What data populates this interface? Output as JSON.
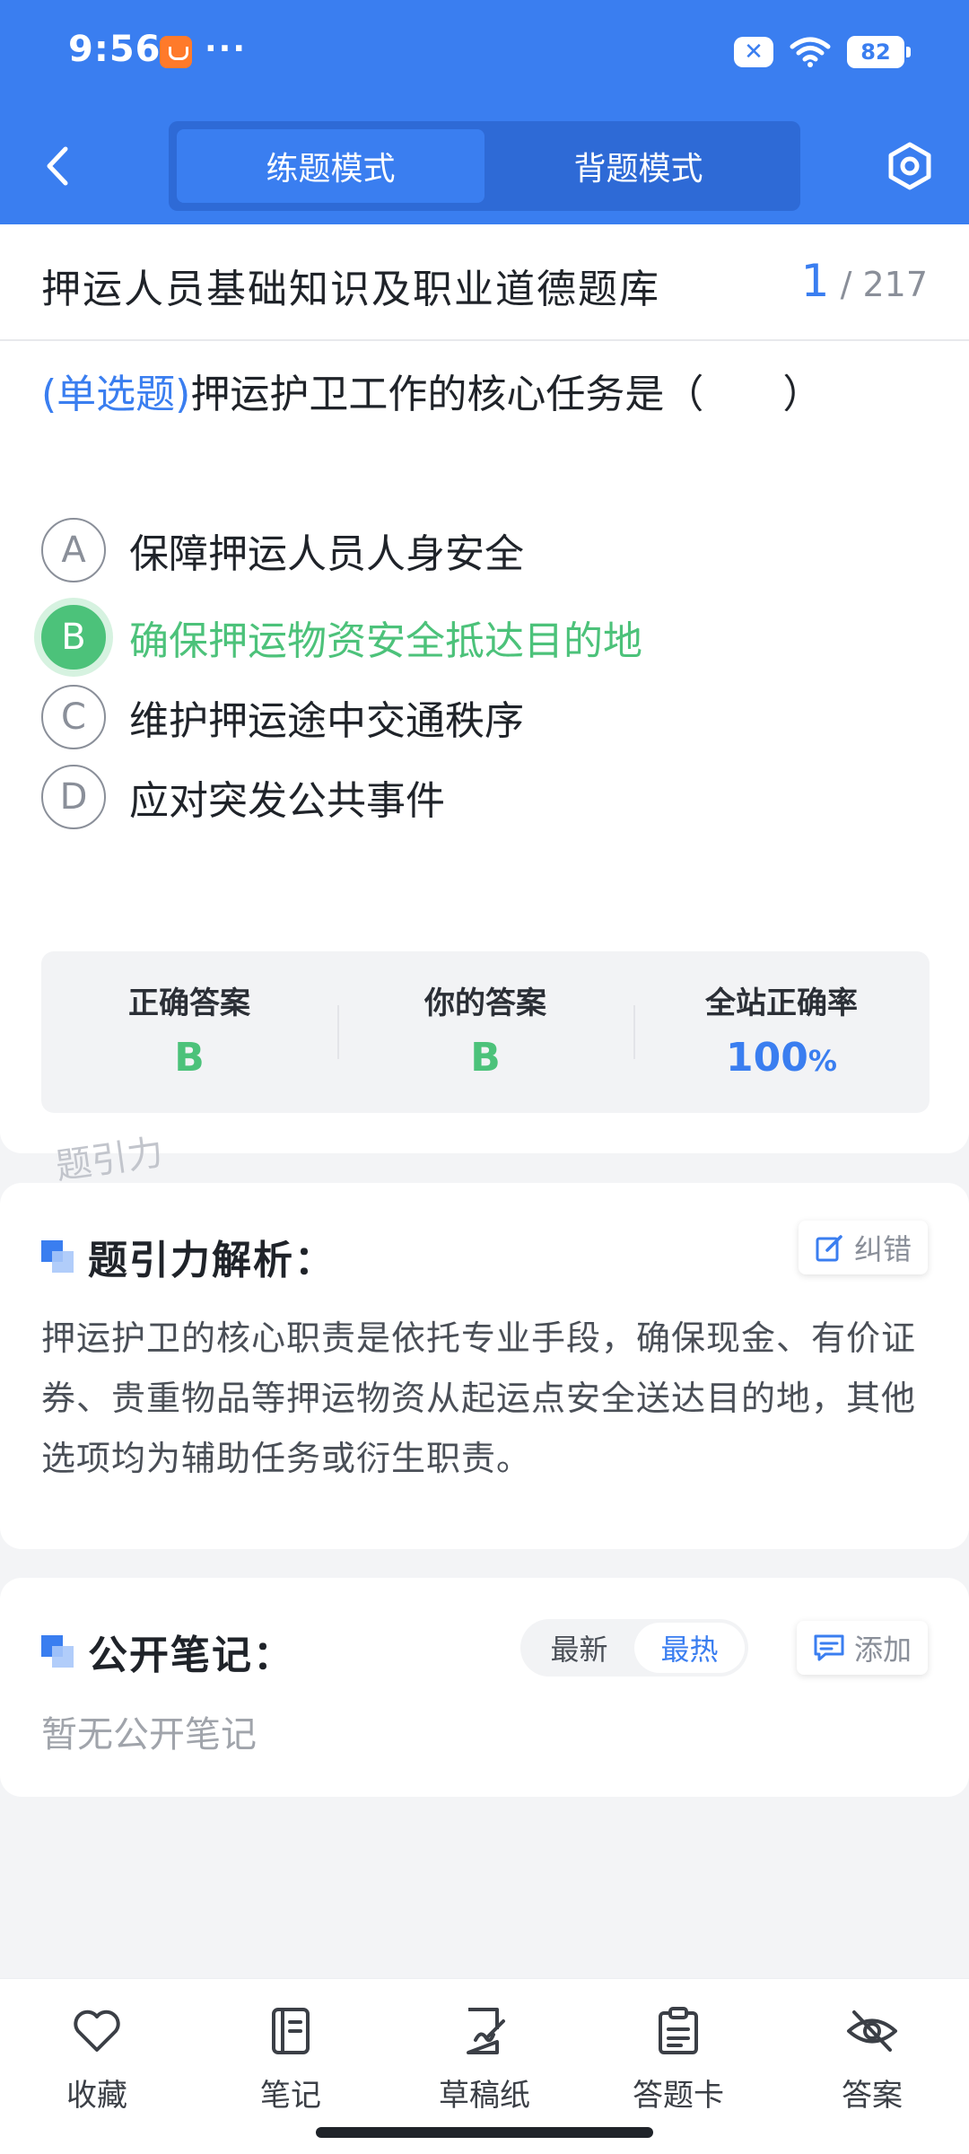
{
  "status_bar": {
    "time": "9:56",
    "more": "···",
    "battery": "82"
  },
  "header": {
    "tabs": [
      {
        "label": "练题模式",
        "active": true
      },
      {
        "label": "背题模式",
        "active": false
      }
    ],
    "back_icon": "chevron-left-icon",
    "settings_icon": "hexagon-settings-icon"
  },
  "bank": {
    "title": "押运人员基础知识及职业道德题库",
    "current": "1",
    "separator": "/",
    "total": "217"
  },
  "question": {
    "type": "(单选题)",
    "text": "押运护卫工作的核心任务是（　　）",
    "options": [
      {
        "key": "A",
        "text": "保障押运人员人身安全",
        "state": "normal"
      },
      {
        "key": "B",
        "text": "确保押运物资安全抵达目的地",
        "state": "correct"
      },
      {
        "key": "C",
        "text": "维护押运途中交通秩序",
        "state": "normal"
      },
      {
        "key": "D",
        "text": "应对突发公共事件",
        "state": "normal"
      }
    ]
  },
  "answer_summary": {
    "correct_label": "正确答案",
    "correct_value": "B",
    "yours_label": "你的答案",
    "yours_value": "B",
    "rate_label": "全站正确率",
    "rate_value": "100",
    "rate_unit": "%"
  },
  "watermark": "题引力",
  "analysis": {
    "title": "题引力解析：",
    "report_label": "纠错",
    "text": "押运护卫的核心职责是依托专业手段，确保现金、有价证券、贵重物品等押运物资从起运点安全送达目的地，其他选项均为辅助任务或衍生职责。"
  },
  "notes": {
    "title": "公开笔记：",
    "sort": [
      {
        "label": "最新",
        "active": false
      },
      {
        "label": "最热",
        "active": true
      }
    ],
    "add_label": "添加",
    "empty": "暂无公开笔记"
  },
  "bottom_bar": [
    {
      "label": "收藏",
      "icon": "heart-icon"
    },
    {
      "label": "笔记",
      "icon": "notebook-icon"
    },
    {
      "label": "草稿纸",
      "icon": "draft-paper-icon"
    },
    {
      "label": "答题卡",
      "icon": "answer-card-icon"
    },
    {
      "label": "答案",
      "icon": "eye-off-icon"
    }
  ],
  "colors": {
    "primary": "#3a7ef0",
    "correct": "#4cc27a",
    "background": "#f3f4f6"
  }
}
